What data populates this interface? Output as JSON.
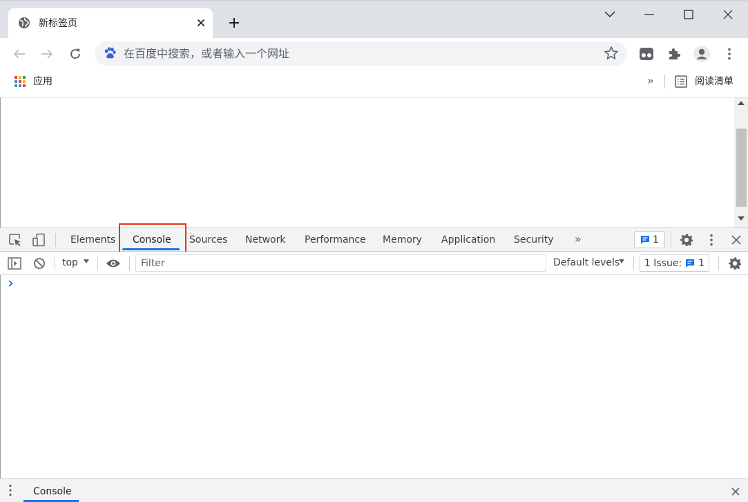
{
  "browser": {
    "tab": {
      "title": "新标签页",
      "favicon": "globe-icon",
      "close_icon": "close-icon"
    },
    "new_tab_icon": "plus-icon",
    "window_controls": [
      "chevron-down-icon",
      "minimize-icon",
      "maximize-icon",
      "close-icon"
    ],
    "toolbar": {
      "back_icon": "arrow-left-icon",
      "forward_icon": "arrow-right-icon",
      "reload_icon": "reload-icon",
      "omnibox": {
        "engine_icon": "baidu-paw-icon",
        "placeholder": "在百度中搜索，或者输入一个网址"
      },
      "bookmark_icon": "star-icon",
      "extensions": [
        "media-icon",
        "puzzle-icon",
        "profile-icon",
        "more-vert-icon"
      ]
    },
    "bookmarks_bar": {
      "apps_label": "应用",
      "overflow": "»",
      "reading_list_label": "阅读清单"
    }
  },
  "devtools": {
    "tabs": [
      {
        "label": "Elements"
      },
      {
        "label": "Console",
        "active": true
      },
      {
        "label": "Sources"
      },
      {
        "label": "Network"
      },
      {
        "label": "Performance"
      },
      {
        "label": "Memory"
      },
      {
        "label": "Application"
      },
      {
        "label": "Security"
      }
    ],
    "more_tabs": "»",
    "issues_badge_count": "1",
    "console_toolbar": {
      "context": "top",
      "filter_placeholder": "Filter",
      "levels": "Default levels",
      "issues_label": "1 Issue:",
      "issues_count": "1"
    },
    "drawer": {
      "tab_label": "Console"
    }
  },
  "colors": {
    "accent": "#1a73e8",
    "highlight": "#e8341c",
    "tabstrip": "#dee1e6",
    "devtools_bar": "#f1f3f4"
  }
}
